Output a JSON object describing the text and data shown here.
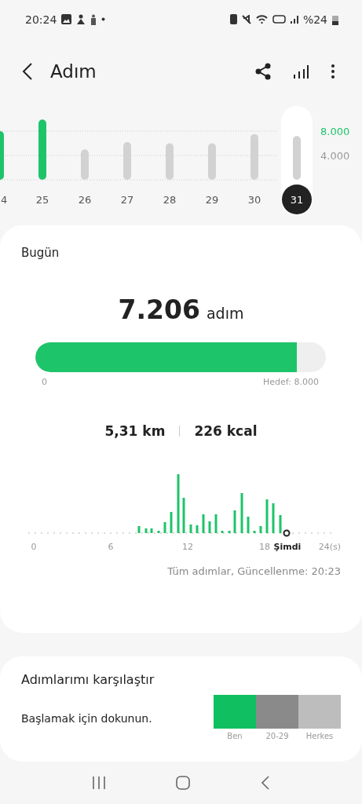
{
  "status_bar": {
    "time": "20:24",
    "battery": "%24"
  },
  "header": {
    "title": "Adım"
  },
  "weekly_chart": {
    "chart_data": {
      "type": "bar",
      "categories": [
        "4",
        "25",
        "26",
        "27",
        "28",
        "29",
        "30",
        "31"
      ],
      "values": [
        8000,
        9900,
        5000,
        6200,
        6000,
        6000,
        7500,
        7200
      ],
      "ylim": [
        0,
        10000
      ],
      "yticks": [
        {
          "value": 4000,
          "label": "4.000"
        },
        {
          "value": 8000,
          "label": "8.000"
        }
      ]
    },
    "days": [
      {
        "selected": false,
        "color": "#1ec46a"
      },
      {
        "selected": false,
        "color": "#1ec46a"
      },
      {
        "selected": false,
        "color": "#d2d2d2"
      },
      {
        "selected": false,
        "color": "#d2d2d2"
      },
      {
        "selected": false,
        "color": "#d2d2d2"
      },
      {
        "selected": false,
        "color": "#d2d2d2"
      },
      {
        "selected": false,
        "color": "#d2d2d2"
      },
      {
        "selected": true,
        "color": "#d2d2d2"
      }
    ]
  },
  "today": {
    "title": "Bugün",
    "steps": "7.206",
    "unit": "adım",
    "progress": {
      "level": 0.9,
      "start": "0",
      "goal": "Hedef: 8.000"
    },
    "distance": "5,31 km",
    "calories": "226 kcal",
    "hourly_axis": [
      "0",
      "6",
      "12",
      "18"
    ],
    "now_label": "Şimdi",
    "end_label": "24(s)",
    "updated": "Tüm adımlar, Güncellenme: 20:23"
  },
  "compare": {
    "title": "Adımlarımı karşılaştır",
    "hint": "Başlamak için dokunun.",
    "groups": [
      {
        "label": "Ben",
        "color": "#10c060"
      },
      {
        "label": "20-29",
        "color": "#8a8a8a"
      },
      {
        "label": "Herkes",
        "color": "#bdbdbd"
      }
    ]
  }
}
